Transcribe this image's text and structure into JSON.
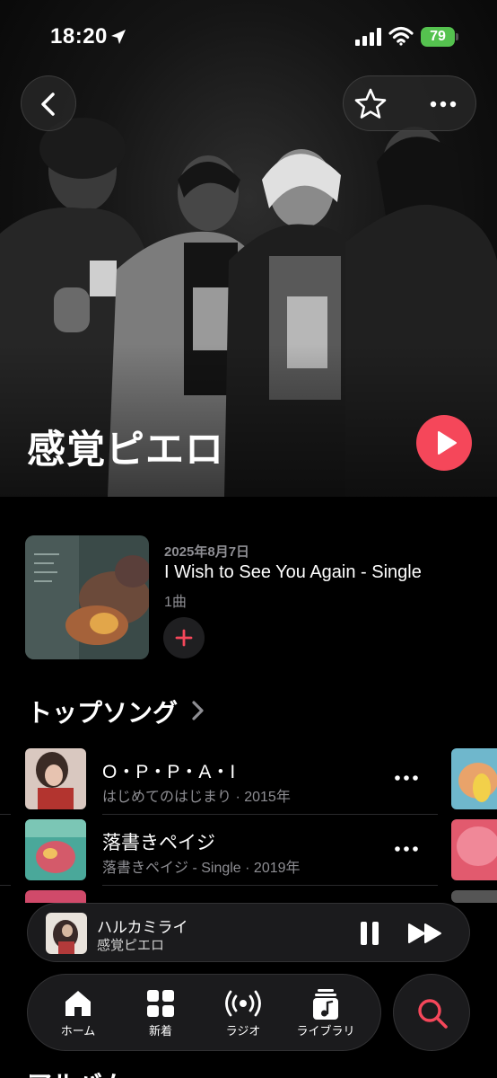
{
  "status_bar": {
    "time": "18:20",
    "battery": "79"
  },
  "artist": {
    "name": "感覚ピエロ"
  },
  "latest_release": {
    "date": "2025年8月7日",
    "title": "I Wish to See You Again - Single",
    "track_count": "1曲"
  },
  "top_songs": {
    "section_title": "トップソング",
    "songs": [
      {
        "title": "O・P・P・A・I",
        "subtitle": "はじめてのはじまり · 2015年"
      },
      {
        "title": "落書きペイジ",
        "subtitle": "落書きペイジ - Single · 2019年"
      }
    ]
  },
  "now_playing": {
    "title": "ハルカミライ",
    "artist": "感覚ピエロ"
  },
  "tab_bar": {
    "tabs": [
      {
        "label": "ホーム",
        "icon": "home-icon",
        "active": true
      },
      {
        "label": "新着",
        "icon": "grid-icon"
      },
      {
        "label": "ラジオ",
        "icon": "radio-icon"
      },
      {
        "label": "ライブラリ",
        "icon": "library-icon"
      }
    ]
  },
  "next_section": {
    "title": "アルバム"
  },
  "colors": {
    "accent": "#f5475a",
    "background": "#000000",
    "secondary_text": "#8e8e93",
    "battery": "#55c24f"
  }
}
